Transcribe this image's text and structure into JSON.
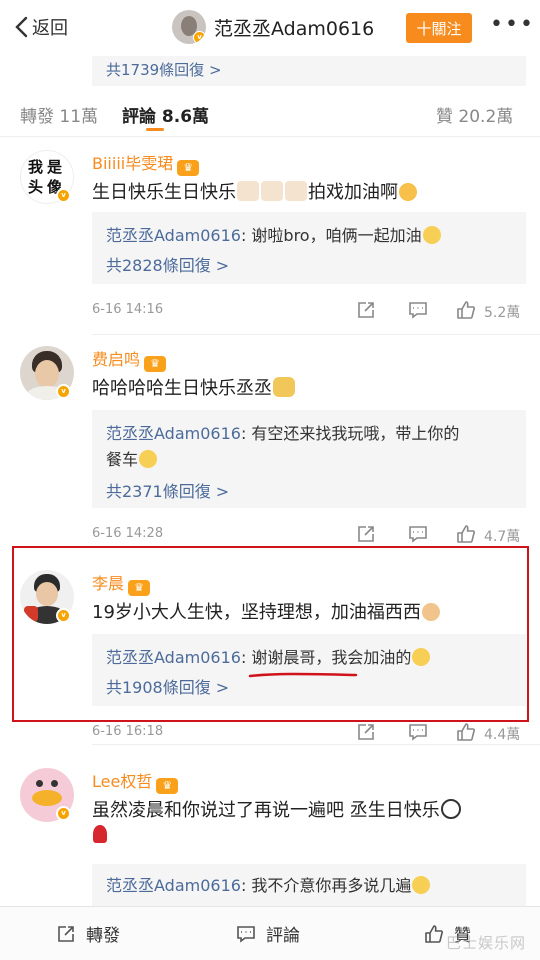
{
  "header": {
    "back_label": "返回",
    "title": "范丞丞Adam0616",
    "follow_label": "十關注",
    "more_icon": "more-dots-icon"
  },
  "previous_reply_count": "共1739條回復 >",
  "tabs": {
    "repost": "轉發 11萬",
    "comments": "評論 8.6萬",
    "likes": "贊 20.2萬"
  },
  "comments": [
    {
      "name": "Biiiii毕雯珺",
      "avatar_text": "我是头像",
      "text": "生日快乐生日快乐",
      "text_suffix": "拍戏加油啊",
      "reply_author": "范丞丞Adam0616",
      "reply_text": ": 谢啦bro，咱俩一起加油",
      "reply_count": "共2828條回復 >",
      "time": "6-16 14:16",
      "likes": "5.2萬"
    },
    {
      "name": "费启鸣",
      "text": "哈哈哈哈生日快乐丞丞",
      "reply_author": "范丞丞Adam0616",
      "reply_text": ": 有空还来找我玩哦，带上你的",
      "reply_text_2": "餐车",
      "reply_count": "共2371條回復 >",
      "time": "6-16 14:28",
      "likes": "4.7萬"
    },
    {
      "name": "李晨",
      "text": "19岁小大人生快，坚持理想，加油福西西",
      "reply_author": "范丞丞Adam0616",
      "reply_text": ": 谢谢晨哥，我会加油的",
      "reply_count": "共1908條回復 >",
      "time": "6-16 16:18",
      "likes": "4.4萬"
    },
    {
      "name": "Lee权哲",
      "text": "虽然凌晨和你说过了再说一遍吧 丞生日快乐",
      "reply_author": "范丞丞Adam0616",
      "reply_text": ": 我不介意你再多说几遍"
    }
  ],
  "bottombar": {
    "repost": "轉發",
    "comment": "評論",
    "like": "贊"
  },
  "watermark": "巴士娱乐网",
  "colors": {
    "accent": "#f78b1e",
    "link": "#4c6b9b",
    "highlight": "#d0121b"
  }
}
